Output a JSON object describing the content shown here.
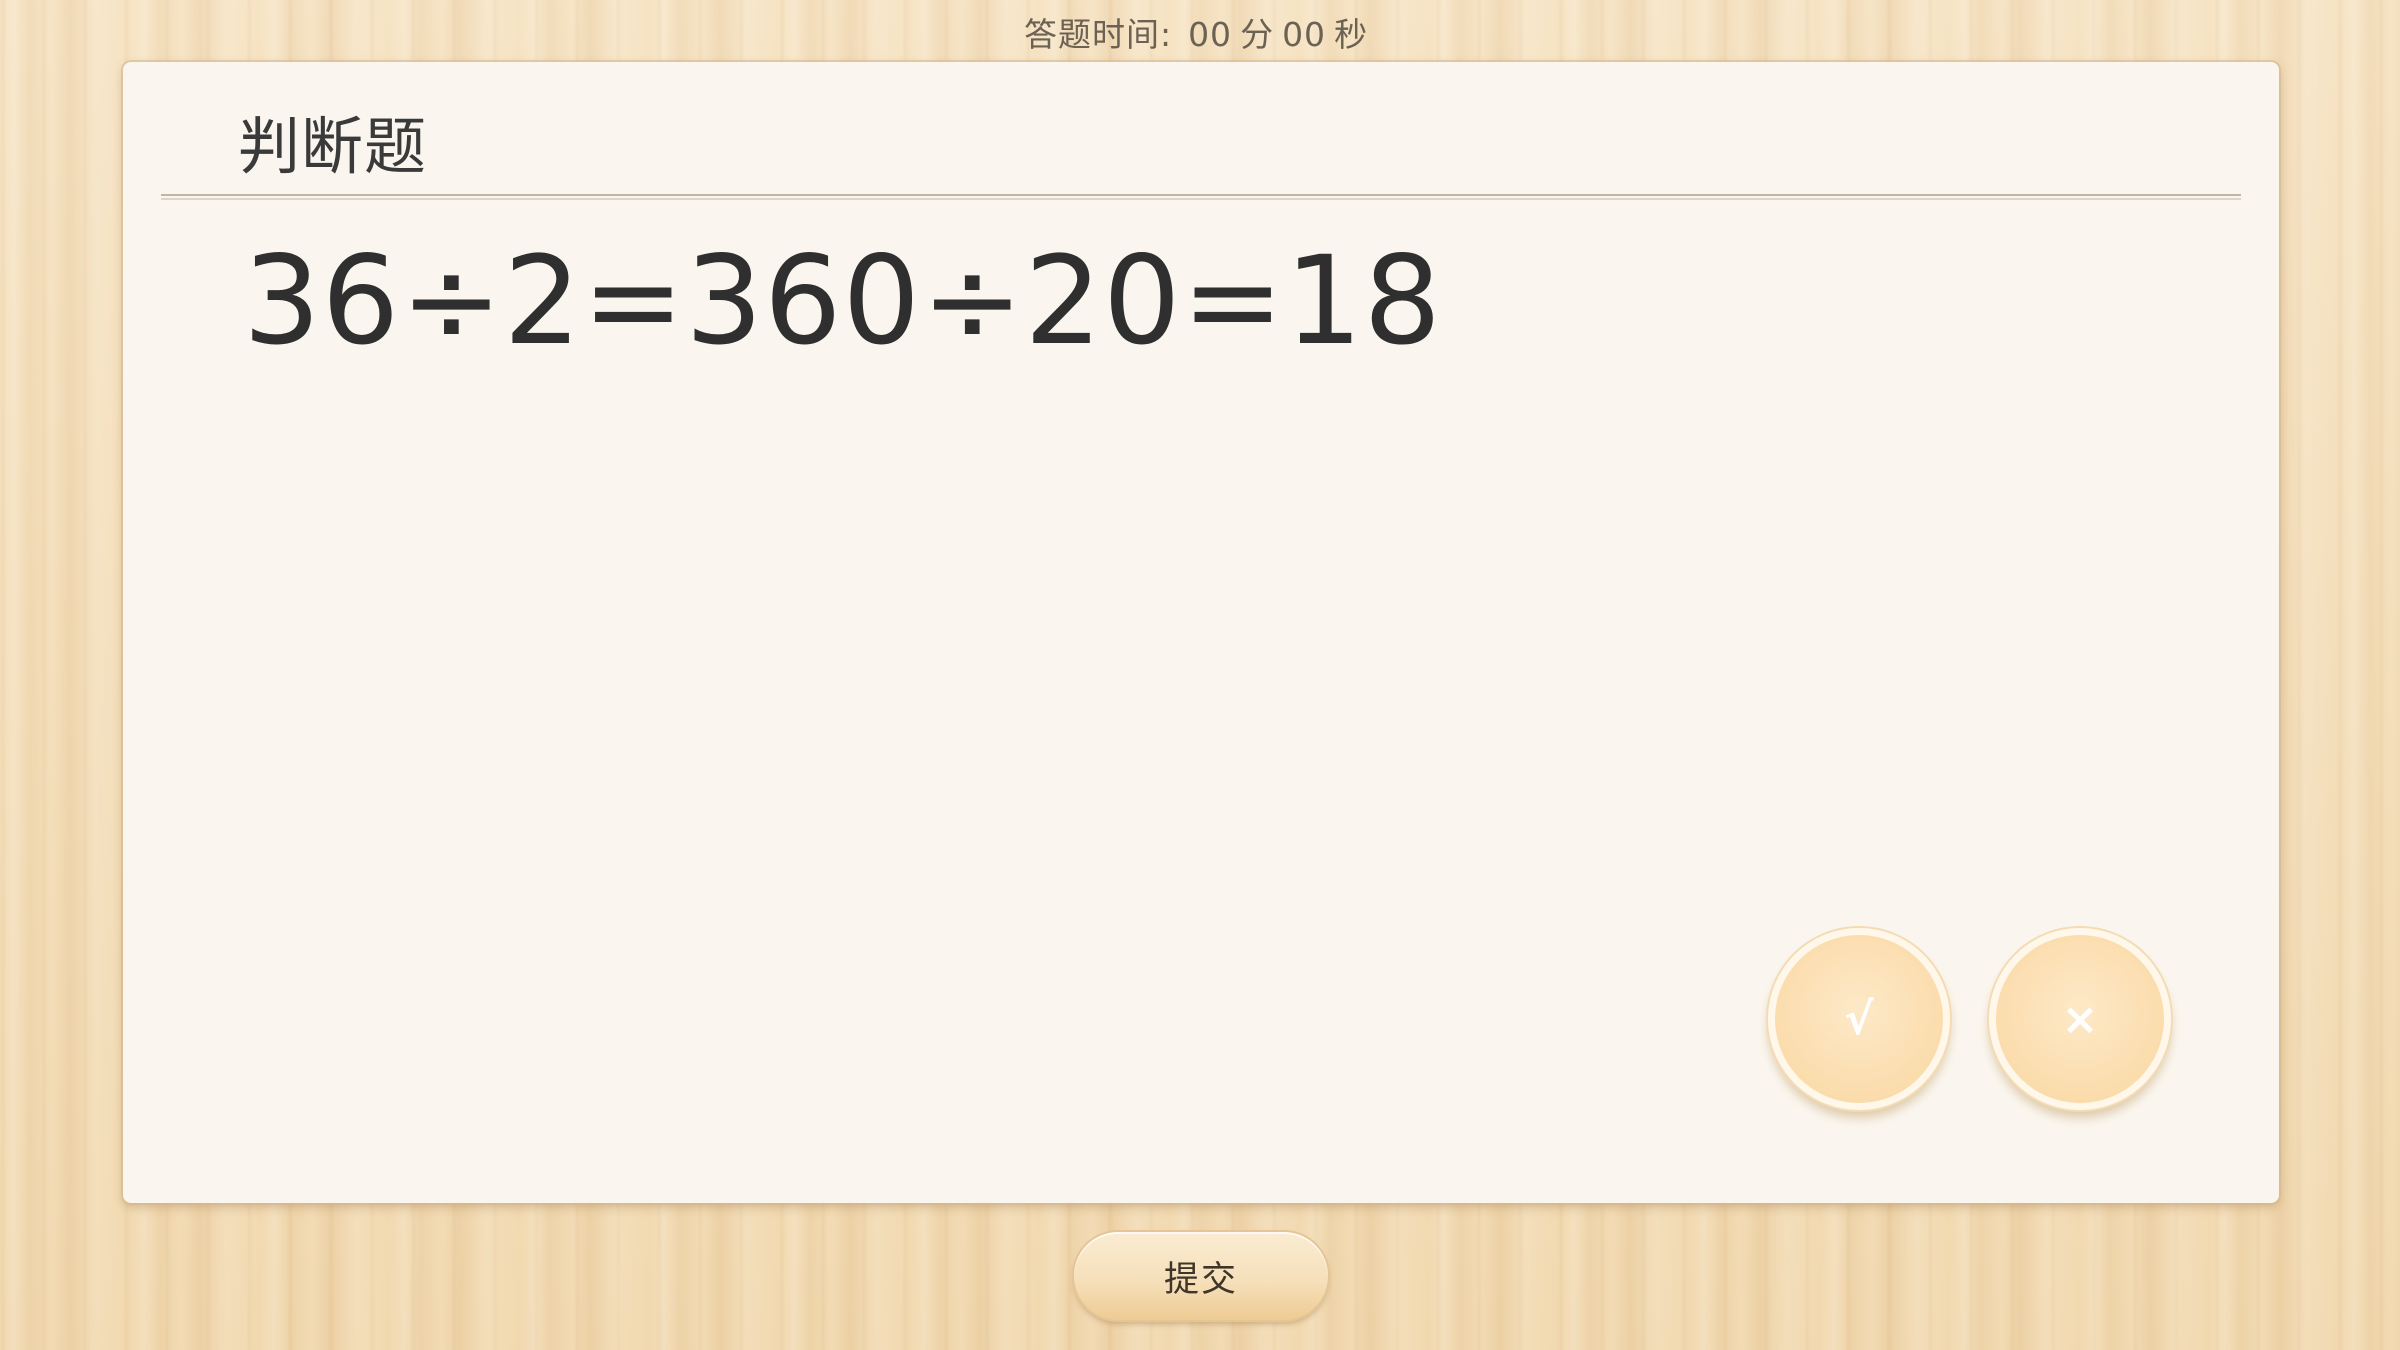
{
  "timer": {
    "label": "答题时间:",
    "minutes": "00",
    "minutes_unit": "分",
    "seconds": "00",
    "seconds_unit": "秒"
  },
  "card": {
    "title": "判断题",
    "question": "36÷2=360÷20=18"
  },
  "answers": {
    "true_label": "√",
    "false_label": "×"
  },
  "footer": {
    "submit_label": "提交"
  },
  "colors": {
    "background_wood": "#f3dcb6",
    "card_bg": "#faf6ef",
    "answer_button": "#fbdcac",
    "text_dark": "#2f2f2f"
  }
}
